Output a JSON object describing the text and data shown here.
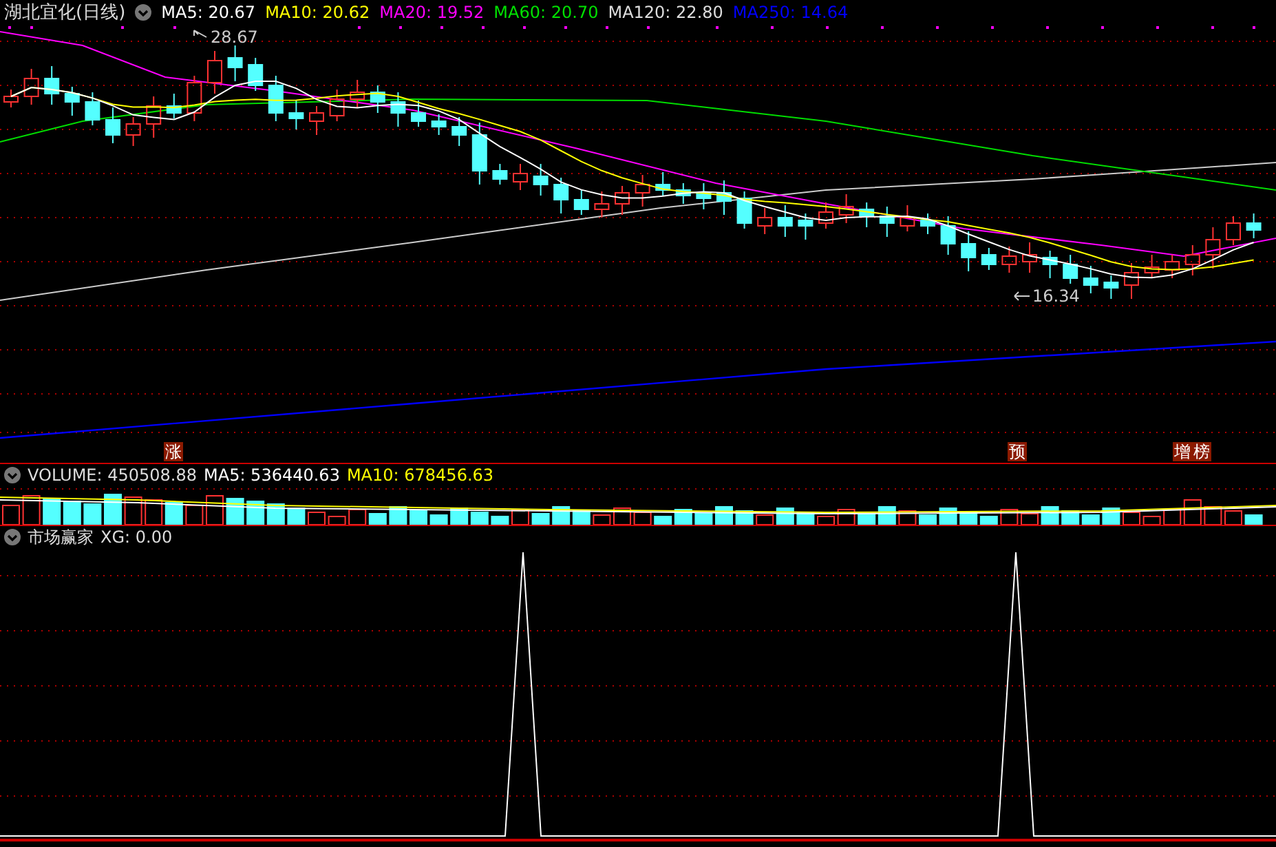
{
  "header": {
    "title": "湖北宜化(日线)",
    "indicators": [
      {
        "label": "MA5: 20.67",
        "color": "#ffffff"
      },
      {
        "label": "MA10: 20.62",
        "color": "#ffff00"
      },
      {
        "label": "MA20: 19.52",
        "color": "#ff00ff"
      },
      {
        "label": "MA60: 20.70",
        "color": "#00e000"
      },
      {
        "label": "MA120: 22.80",
        "color": "#dddddd"
      },
      {
        "label": "MA250: 14.64",
        "color": "#0000ff"
      }
    ]
  },
  "main_chart": {
    "high_label": "28.67",
    "low_label": "16.34",
    "signals": [
      {
        "text": "涨"
      },
      {
        "text": "预"
      },
      {
        "text": "增"
      },
      {
        "text": "榜"
      }
    ]
  },
  "volume": {
    "indicators": [
      {
        "label": "VOLUME: 450508.88",
        "color": "#dddddd"
      },
      {
        "label": "MA5: 536440.63",
        "color": "#ffffff"
      },
      {
        "label": "MA10: 678456.63",
        "color": "#ffff00"
      }
    ]
  },
  "indicator_panel": {
    "title": "市场赢家",
    "reading": "XG: 0.00"
  }
}
